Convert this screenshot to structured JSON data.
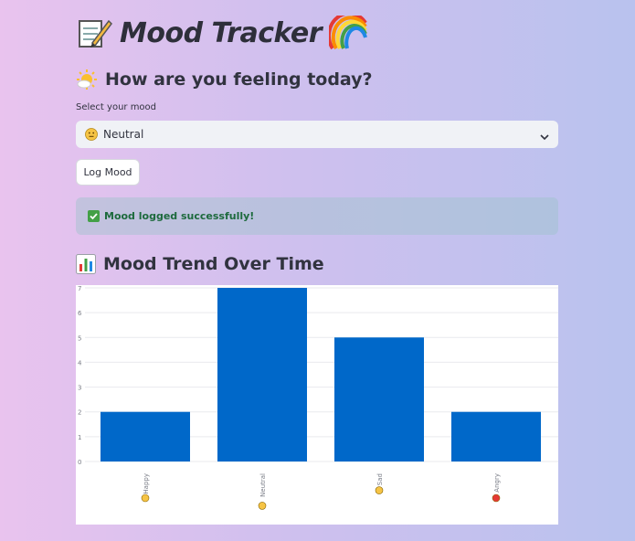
{
  "app": {
    "title": "Mood Tracker",
    "title_emoji_left": "memo-icon",
    "title_emoji_right": "rainbow-icon"
  },
  "mood_form": {
    "subheader": "How are you feeling today?",
    "subheader_icon": "sun-behind-cloud-icon",
    "select_label": "Select your mood",
    "selected_value": "Neutral",
    "selected_icon": "neutral-face-icon",
    "button_label": "Log Mood"
  },
  "alert": {
    "icon": "check-mark-icon",
    "message": "Mood logged successfully!",
    "color": "#1d6a3d"
  },
  "chart_section": {
    "title": "Mood Trend Over Time",
    "icon": "bar-chart-icon"
  },
  "chart_data": {
    "type": "bar",
    "categories": [
      "Happy",
      "Neutral",
      "Sad",
      "Angry"
    ],
    "category_icons": [
      "happy-face-icon",
      "neutral-face-icon",
      "sad-face-icon",
      "angry-face-icon"
    ],
    "values": [
      2,
      7,
      5,
      2
    ],
    "ylim": [
      0,
      7
    ],
    "yticks": [
      "0",
      "1",
      "2",
      "3",
      "4",
      "5",
      "6",
      "7"
    ],
    "grid": true,
    "bar_color": "#0068c9"
  }
}
